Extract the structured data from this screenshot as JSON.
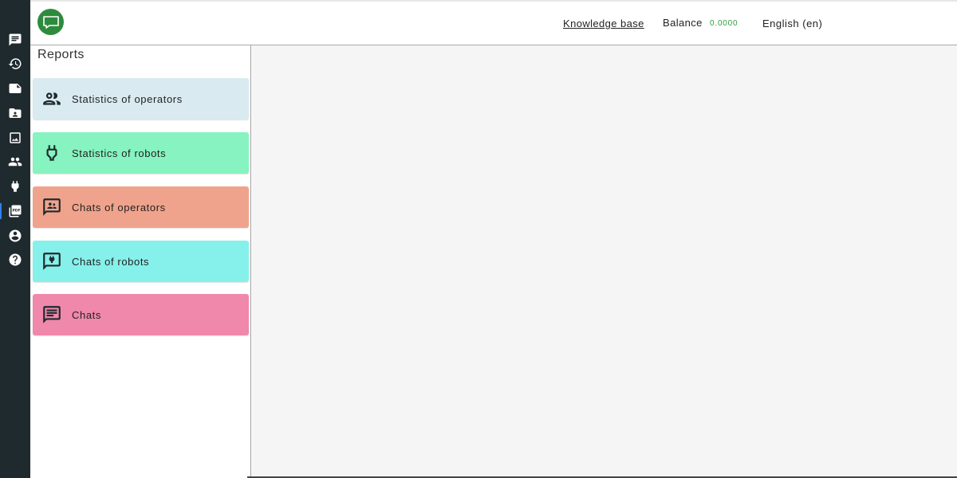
{
  "app": {
    "logo_icon": "chat-bubble-icon",
    "brand_color": "#2e8b3e"
  },
  "sidebar": {
    "items": [
      {
        "icon": "chat-icon",
        "active": false
      },
      {
        "icon": "history-icon",
        "active": false
      },
      {
        "icon": "note-icon",
        "active": false
      },
      {
        "icon": "contact-folder-icon",
        "active": false
      },
      {
        "icon": "image-icon",
        "active": false
      },
      {
        "icon": "people-icon",
        "active": false
      },
      {
        "icon": "plug-icon",
        "active": false
      },
      {
        "icon": "pdf-icon",
        "active": true
      },
      {
        "icon": "account-circle-icon",
        "active": false
      },
      {
        "icon": "help-icon",
        "active": false
      }
    ]
  },
  "header": {
    "knowledge_base": "Knowledge base",
    "balance_label": "Balance",
    "balance_value": "0.0000",
    "language": "English (en)"
  },
  "reports": {
    "title": "Reports",
    "items": [
      {
        "label": "Statistics of operators",
        "icon": "operators-icon",
        "color": "#d9eaf0"
      },
      {
        "label": "Statistics of robots",
        "icon": "plug-icon",
        "color": "#86f3c0"
      },
      {
        "label": "Chats of operators",
        "icon": "operator-chat-icon",
        "color": "#f0a38c"
      },
      {
        "label": "Chats of robots",
        "icon": "robot-chat-icon",
        "color": "#86f0ea"
      },
      {
        "label": "Chats",
        "icon": "chat-lines-icon",
        "color": "#f088ab"
      }
    ]
  }
}
